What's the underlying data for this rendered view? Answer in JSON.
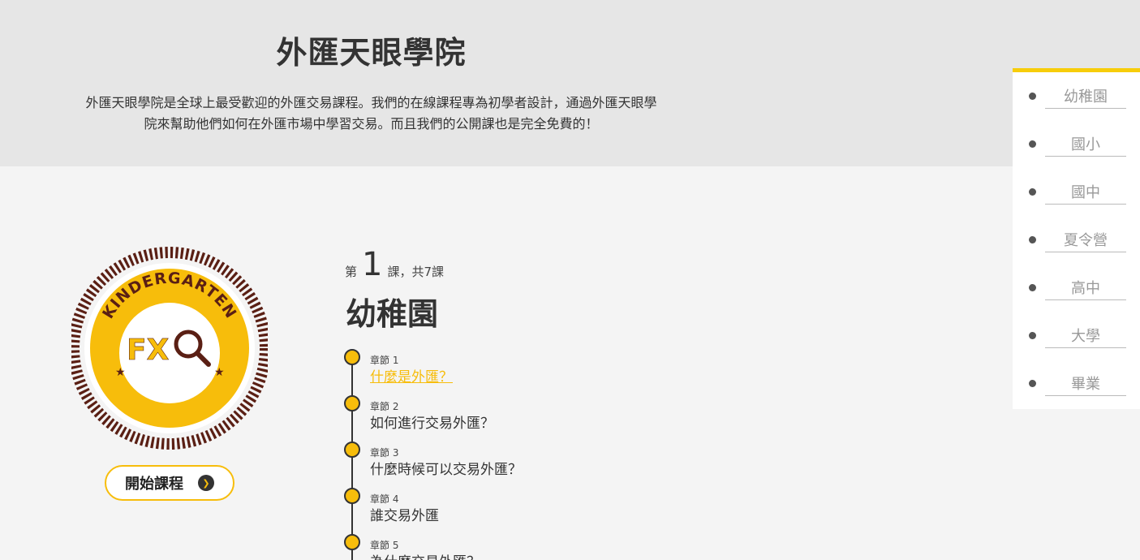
{
  "hero": {
    "title": "外匯天眼學院",
    "description_line1": "外匯天眼學院是全球上最受歡迎的外匯交易課程。我們的在線課程專為初學者設計，通過外匯天眼學",
    "description_line2": "院來幫助他們如何在外匯市場中學習交易。而且我們的公開課也是完全免費的！"
  },
  "badge": {
    "arc_text": "KINDERGARTEN",
    "logo_text": "FX",
    "icon": "magnifier-icon"
  },
  "start_button": {
    "label": "開始課程",
    "icon": "chevron-right-icon"
  },
  "lesson": {
    "prefix": "第",
    "number": "1",
    "suffix": "課，共7課",
    "title": "幼稚園"
  },
  "chapters": [
    {
      "label": "章節 1",
      "title": "什麼是外匯？",
      "active": true
    },
    {
      "label": "章節 2",
      "title": "如何進行交易外匯？",
      "active": false
    },
    {
      "label": "章節 3",
      "title": "什麼時候可以交易外匯？",
      "active": false
    },
    {
      "label": "章節 4",
      "title": "誰交易外匯",
      "active": false
    },
    {
      "label": "章節 5",
      "title": "為什麼交易外匯？",
      "active": false
    }
  ],
  "side_nav": {
    "items": [
      "幼稚園",
      "國小",
      "國中",
      "夏令營",
      "高中",
      "大學",
      "畢業"
    ]
  },
  "colors": {
    "accent": "#f7bd0b",
    "badge_brown": "#5a1f14",
    "hero_bg": "#e6e6e6",
    "page_bg": "#f4f4f4"
  }
}
